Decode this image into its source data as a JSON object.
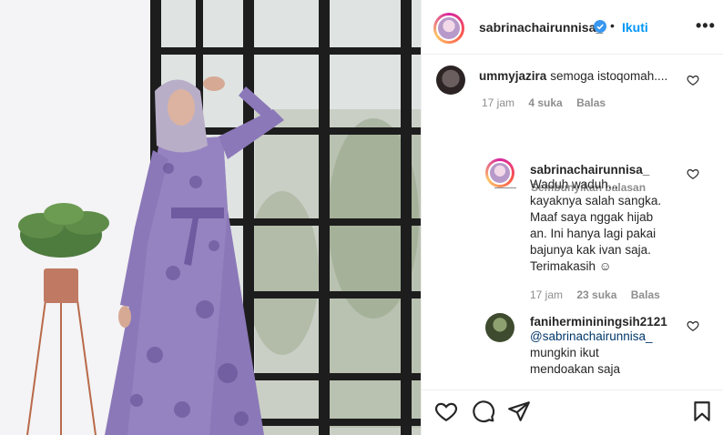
{
  "post": {
    "username": "sabrinachairunnisa_",
    "follow_label": "Ikuti",
    "dot": "•",
    "more": "•••"
  },
  "comments": [
    {
      "username": "ummyjazira",
      "text": "semoga istoqomah....",
      "time": "17 jam",
      "likes": "4 suka",
      "reply": "Balas"
    }
  ],
  "hide_replies": "Sembunyikan balasan",
  "replies": [
    {
      "username": "sabrinachairunnisa_",
      "lines": [
        "Waduh waduh...",
        "kayaknya salah sangka.",
        "Maaf saya nggak hijab",
        "an. Ini hanya lagi pakai",
        "bajunya kak ivan saja.",
        "Terimakasih ☺"
      ],
      "time": "17 jam",
      "likes": "23 suka",
      "reply": "Balas"
    },
    {
      "username": "fanihermininingsih2121",
      "mention": "@sabrinachairunnisa_",
      "lines": [
        "mungkin ikut",
        "mendoakan saja"
      ]
    }
  ],
  "icons": [
    "verified-icon",
    "heart-icon",
    "comment-icon",
    "share-icon",
    "bookmark-icon",
    "more-icon"
  ],
  "colors": {
    "link": "#0095f6",
    "muted": "#8e8e8e",
    "text": "#262626",
    "dress": "#8b78b8"
  }
}
